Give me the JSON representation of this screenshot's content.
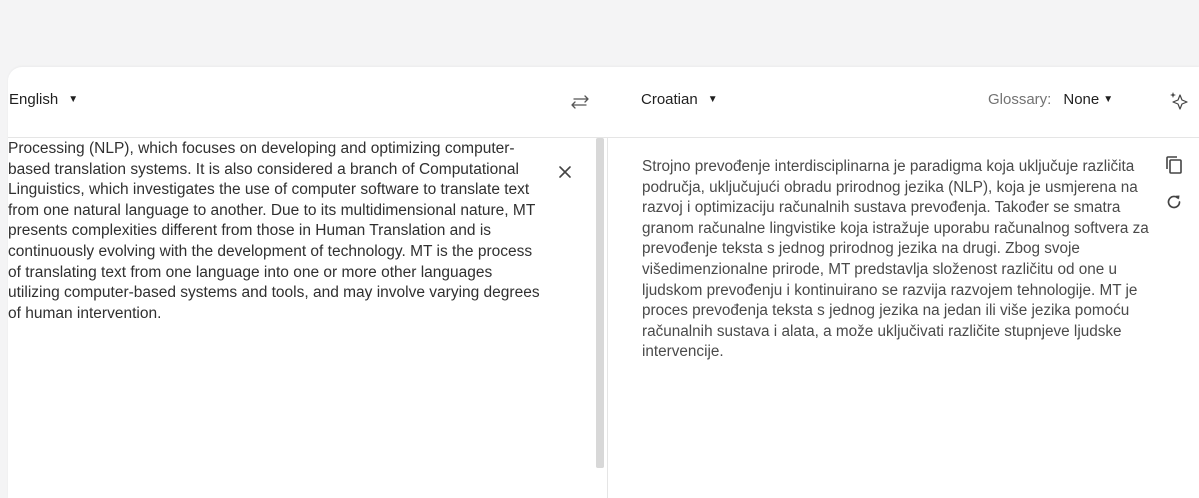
{
  "source_lang": {
    "label": "English",
    "caret": "▼"
  },
  "target_lang": {
    "label": "Croatian",
    "caret": "▼"
  },
  "glossary": {
    "label": "Glossary:",
    "value": "None",
    "caret": "▼"
  },
  "icons": {
    "swap": "swap-languages-icon",
    "magic": "sparkle-icon",
    "clear": "close-icon",
    "copy": "copy-icon",
    "refresh": "refresh-icon"
  },
  "source_text": "Processing (NLP), which focuses on developing and optimizing computer-based translation systems. It is also considered a branch of Computational Linguistics, which investigates the use of computer software to translate text from one natural language to another. Due to its multidimensional nature, MT presents complexities different from those in Human Translation and is continuously evolving with the development of technology. MT is the process of translating text from one language into one or more other languages utilizing computer-based systems and tools, and may involve varying degrees of human intervention.",
  "target_text": "Strojno prevođenje interdisciplinarna je paradigma koja uključuje različita područja, uključujući obradu prirodnog jezika (NLP), koja je usmjerena na razvoj i optimizaciju računalnih sustava prevođenja. Također se smatra granom računalne lingvistike koja istražuje uporabu računalnog softvera za prevođenje teksta s jednog prirodnog jezika na drugi. Zbog svoje višedimenzionalne prirode, MT predstavlja složenost različitu od one u ljudskom prevođenju i kontinuirano se razvija razvojem tehnologije. MT je proces prevođenja teksta s jednog jezika na jedan ili više jezika pomoću računalnih sustava i alata, a može uključivati različite stupnjeve ljudske intervencije."
}
